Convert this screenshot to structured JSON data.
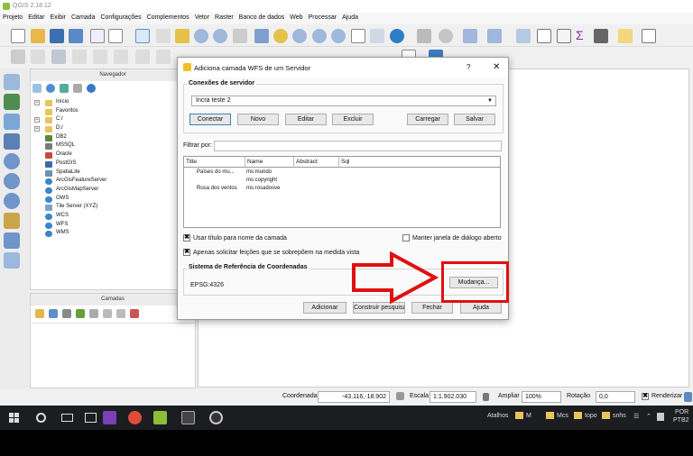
{
  "window": {
    "title": "QGIS 2.18.12"
  },
  "menu": [
    "Projeto",
    "Editar",
    "Exibir",
    "Camada",
    "Configurações",
    "Complementos",
    "Vetor",
    "Raster",
    "Banco de dados",
    "Web",
    "Processar",
    "Ajuda"
  ],
  "panels": {
    "navigator": {
      "title": "Navegador",
      "items": [
        "Início",
        "Favoritos",
        "C:/",
        "D:/",
        "DB2",
        "MSSQL",
        "Oracle",
        "PostGIS",
        "SpatiaLite",
        "ArcGisFeatureServer",
        "ArcGisMapServer",
        "OWS",
        "Tile Server (XYZ)",
        "WCS",
        "WFS",
        "WMS"
      ]
    },
    "layers": {
      "title": "Camadas"
    }
  },
  "dialog": {
    "title": "Adiciona camada WFS de um Servidor",
    "help": "?",
    "close": "✕",
    "connections": {
      "group_title": "Conexões de servidor",
      "selected": "Incra teste 2",
      "buttons": [
        "Conectar",
        "Novo",
        "Editar",
        "Excluir",
        "Carregar",
        "Salvar"
      ]
    },
    "filter_label": "Filtrar por:",
    "table": {
      "headers": [
        "Title",
        "Name",
        "Abstract",
        "Sql"
      ],
      "rows": [
        {
          "title": "Païses do mu...",
          "name": "ms:mundo"
        },
        {
          "title": "",
          "name": "ms:copyright"
        },
        {
          "title": "Rosa dos ventos",
          "name": "ms:rosadosve"
        }
      ]
    },
    "options": {
      "use_title": "Usar título para nome da camada",
      "keep_open": "Manter janela de diálogo aberto",
      "only_overlap": "Apenas solicitar feições que se sobrepõem na medida vista"
    },
    "crs": {
      "group_title": "Sistema de Referência de Coordenadas",
      "value": "EPSG:4326",
      "change_button": "Mudança..."
    },
    "footer_buttons": [
      "Adicionar",
      "Construir pesquisa",
      "Fechar",
      "Ajuda"
    ]
  },
  "statusbar": {
    "coord_label": "Coordenada",
    "coord_value": "-43.116,-18.902",
    "scale_label": "Escala",
    "scale_value": "1:1.902.030",
    "zoom_label": "Ampliar",
    "zoom_value": "100%",
    "rotation_label": "Rotação",
    "rotation_value": "0,0",
    "render_label": "Renderizar"
  },
  "taskbar": {
    "atalhos": "Atalhos",
    "folders": [
      "M",
      "Mcs",
      "topo",
      "snhs"
    ],
    "lang": "POR",
    "layout": "PTB2"
  },
  "colors": {
    "accent_red": "#e01010"
  }
}
